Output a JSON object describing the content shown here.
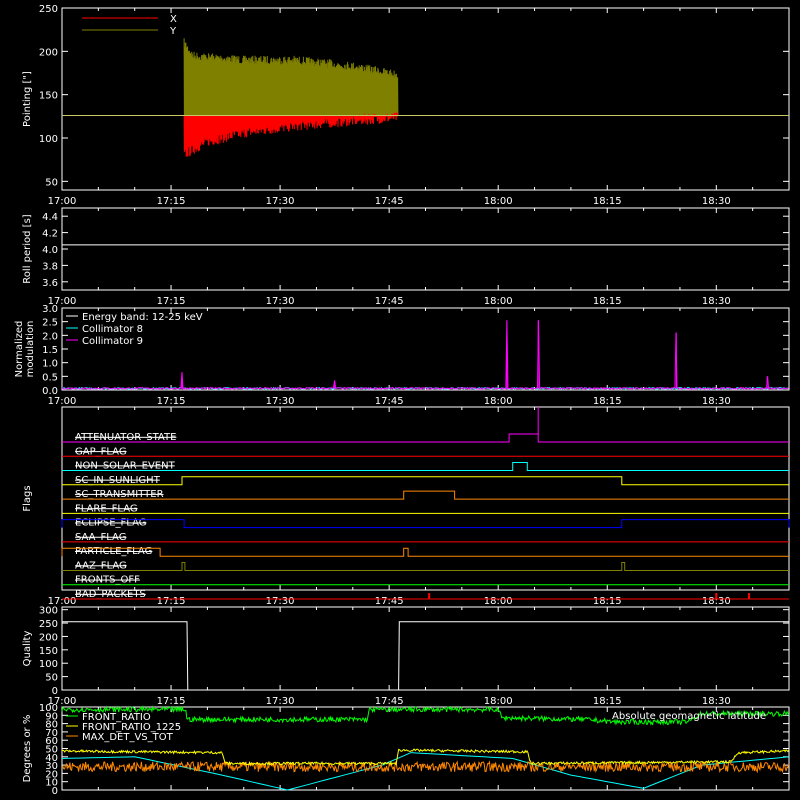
{
  "colors": {
    "background": "#000000",
    "axes": "#ffffff",
    "x": "#ff0000",
    "y": "#808000",
    "ref_line": "#c8c864",
    "collimator8": "#00ffff",
    "collimator9": "#ff00ff",
    "front_ratio": "#00ff00",
    "front_ratio_1225": "#ffff00",
    "max_det": "#ff8800",
    "geomag": "#00ffff"
  },
  "chart_data": [
    {
      "id": "pointing",
      "type": "line",
      "ylabel": "Pointing [\"]",
      "ylim": [
        40,
        250
      ],
      "yticks": [
        "50",
        "100",
        "150",
        "200",
        "250"
      ],
      "ytick_values": [
        50,
        100,
        150,
        200,
        250
      ],
      "x_ticks": [
        "17:00",
        "17:15",
        "17:30",
        "17:45",
        "18:00",
        "18:15",
        "18:30"
      ],
      "x_tick_minutes": [
        0,
        15,
        30,
        45,
        60,
        75,
        90
      ],
      "xlim_minutes": [
        0,
        100
      ],
      "reference_level": 126,
      "legend": [
        {
          "name": "X",
          "color": "#ff0000"
        },
        {
          "name": "Y",
          "color": "#808000"
        }
      ],
      "series": [
        {
          "name": "Y",
          "start": 16.8,
          "end": 46.2,
          "upper": [
            [
              16.8,
              215
            ],
            [
              18,
              200
            ],
            [
              25,
              195
            ],
            [
              32,
              195
            ],
            [
              40,
              188
            ],
            [
              46.2,
              178
            ]
          ],
          "lower": [
            [
              16.8,
              126
            ],
            [
              46.2,
              126
            ]
          ]
        },
        {
          "name": "X",
          "start": 16.8,
          "end": 46.2,
          "upper": [
            [
              16.8,
              126
            ],
            [
              46.2,
              126
            ]
          ],
          "lower": [
            [
              16.8,
              75
            ],
            [
              20,
              90
            ],
            [
              25,
              100
            ],
            [
              32,
              108
            ],
            [
              40,
              114
            ],
            [
              46.2,
              118
            ]
          ]
        }
      ]
    },
    {
      "id": "roll",
      "type": "line",
      "ylabel": "Roll period [s]",
      "ylim": [
        3.5,
        4.5
      ],
      "yticks": [
        "3.6",
        "3.8",
        "4.0",
        "4.2",
        "4.4"
      ],
      "ytick_values": [
        3.6,
        3.8,
        4.0,
        4.2,
        4.4
      ],
      "x_ticks": [
        "17:00",
        "17:15",
        "17:30",
        "17:45",
        "18:00",
        "18:15",
        "18:30"
      ],
      "x_tick_minutes": [
        0,
        15,
        30,
        45,
        60,
        75,
        90
      ],
      "xlim_minutes": [
        0,
        100
      ],
      "series": [
        {
          "name": "",
          "points": [
            [
              0,
              4.05
            ],
            [
              100,
              4.05
            ]
          ]
        }
      ]
    },
    {
      "id": "modulation",
      "type": "line",
      "ylabel": "Normalized\nmodulation",
      "ylim": [
        0,
        3.0
      ],
      "yticks": [
        "0.0",
        "0.5",
        "1.0",
        "1.5",
        "2.0",
        "2.5",
        "3.0"
      ],
      "ytick_values": [
        0,
        0.5,
        1.0,
        1.5,
        2.0,
        2.5,
        3.0
      ],
      "x_ticks": [
        "17:00",
        "17:15",
        "17:30",
        "17:45",
        "18:00",
        "18:15",
        "18:30"
      ],
      "x_tick_minutes": [
        0,
        15,
        30,
        45,
        60,
        75,
        90
      ],
      "xlim_minutes": [
        0,
        100
      ],
      "legend": [
        {
          "name": "Energy band: 12-25 keV",
          "color": "#ffffff"
        },
        {
          "name": "Collimator 8",
          "color": "#00ffff"
        },
        {
          "name": "Collimator 9",
          "color": "#ff00ff"
        }
      ],
      "spikes": [
        [
          16.5,
          0.65
        ],
        [
          37.5,
          0.35
        ],
        [
          61.2,
          2.55
        ],
        [
          65.5,
          2.55
        ],
        [
          84.5,
          2.1
        ],
        [
          97,
          0.5
        ]
      ]
    },
    {
      "id": "flags",
      "type": "line",
      "ylabel": "Flags",
      "x_ticks": [
        "17:00",
        "17:15",
        "17:30",
        "17:45",
        "18:00",
        "18:15",
        "18:30"
      ],
      "x_tick_minutes": [
        0,
        15,
        30,
        45,
        60,
        75,
        90
      ],
      "xlim_minutes": [
        0,
        100
      ],
      "flags": [
        {
          "name": "ATTENUATOR_STATE",
          "color": "#ff00ff",
          "segments": [
            [
              61.5,
              65.5,
              1
            ],
            [
              65.5,
              100,
              0
            ]
          ],
          "spike": [
            65.5,
            2
          ]
        },
        {
          "name": "GAP_FLAG",
          "color": "#ff0000",
          "segments": []
        },
        {
          "name": "NON_SOLAR_EVENT",
          "color": "#00ffff",
          "segments": [
            [
              62,
              64,
              1
            ]
          ]
        },
        {
          "name": "SC_IN_SUNLIGHT",
          "color": "#ffff00",
          "segments": [
            [
              16.5,
              77,
              1
            ]
          ]
        },
        {
          "name": "SC_TRANSMITTER",
          "color": "#ff8800",
          "segments": [
            [
              47,
              54,
              1
            ]
          ]
        },
        {
          "name": "FLARE_FLAG",
          "color": "#ffff00",
          "segments": []
        },
        {
          "name": "ECLIPSE_FLAG",
          "color": "#0000ff",
          "segments": [
            [
              0,
              16.8,
              1
            ],
            [
              77,
              100,
              1
            ]
          ]
        },
        {
          "name": "SAA_FLAG",
          "color": "#ff0000",
          "segments": []
        },
        {
          "name": "PARTICLE_FLAG",
          "color": "#ff8800",
          "segments": [
            [
              0,
              13.5,
              1
            ],
            [
              47,
              47.6,
              1
            ]
          ]
        },
        {
          "name": "AAZ_FLAG",
          "color": "#808000",
          "segments": [
            [
              16.5,
              16.9,
              1
            ],
            [
              77,
              77.4,
              1
            ]
          ]
        },
        {
          "name": "FRONTS_OFF",
          "color": "#00ff00",
          "segments": []
        },
        {
          "name": "BAD_PACKETS",
          "color": "#ff0000",
          "spikes_at": [
            50.5,
            90,
            94.5
          ]
        }
      ]
    },
    {
      "id": "quality",
      "type": "line",
      "ylabel": "Quality",
      "ylim": [
        0,
        310
      ],
      "yticks": [
        "0",
        "50",
        "100",
        "150",
        "200",
        "250",
        "300"
      ],
      "ytick_values": [
        0,
        50,
        100,
        150,
        200,
        250,
        300
      ],
      "x_ticks": [
        "17:00",
        "17:15",
        "17:30",
        "17:45",
        "18:00",
        "18:15",
        "18:30"
      ],
      "x_tick_minutes": [
        0,
        15,
        30,
        45,
        60,
        75,
        90
      ],
      "xlim_minutes": [
        0,
        100
      ],
      "series": [
        {
          "name": "",
          "points": [
            [
              0,
              255
            ],
            [
              17.2,
              255
            ],
            [
              17.3,
              0
            ],
            [
              46.3,
              0
            ],
            [
              46.4,
              255
            ],
            [
              100,
              255
            ]
          ]
        }
      ]
    },
    {
      "id": "ratios",
      "type": "line",
      "ylabel": "Degrees or %",
      "ylim": [
        0,
        100
      ],
      "yticks": [
        "0",
        "10",
        "20",
        "30",
        "40",
        "50",
        "60",
        "70",
        "80",
        "90",
        "100"
      ],
      "ytick_values": [
        0,
        10,
        20,
        30,
        40,
        50,
        60,
        70,
        80,
        90,
        100
      ],
      "xlim_minutes": [
        0,
        100
      ],
      "legend": [
        {
          "name": "FRONT_RATIO",
          "color": "#00ff00"
        },
        {
          "name": "FRONT_RATIO_1225",
          "color": "#ffff00"
        },
        {
          "name": "MAX_DET_VS_TOT",
          "color": "#ff8800"
        },
        {
          "name": "Absolute geomagnetic latitude",
          "color": "#00ffff"
        }
      ],
      "series": [
        {
          "name": "FRONT_RATIO",
          "points": [
            [
              0,
              97
            ],
            [
              17,
              97
            ],
            [
              17.2,
              85
            ],
            [
              42,
              85
            ],
            [
              42.3,
              97
            ],
            [
              60,
              97
            ],
            [
              60.5,
              87
            ],
            [
              72,
              85
            ],
            [
              76,
              82
            ],
            [
              86,
              82
            ],
            [
              88,
              92
            ],
            [
              100,
              92
            ]
          ]
        },
        {
          "name": "FRONT_RATIO_1225",
          "points": [
            [
              0,
              47
            ],
            [
              22,
              45
            ],
            [
              22.5,
              32
            ],
            [
              46,
              32
            ],
            [
              46.3,
              48
            ],
            [
              64,
              46
            ],
            [
              64.5,
              32
            ],
            [
              92,
              34
            ],
            [
              93,
              45
            ],
            [
              100,
              47
            ]
          ]
        },
        {
          "name": "MAX_DET_VS_TOT",
          "points": [
            [
              0,
              28
            ],
            [
              100,
              28
            ]
          ]
        },
        {
          "name": "Absolute geomagnetic latitude",
          "points": [
            [
              0,
              38
            ],
            [
              10,
              40
            ],
            [
              22,
              18
            ],
            [
              31,
              0
            ],
            [
              44,
              30
            ],
            [
              48,
              45
            ],
            [
              62,
              38
            ],
            [
              70,
              18
            ],
            [
              80,
              2
            ],
            [
              88,
              30
            ],
            [
              100,
              40
            ]
          ]
        }
      ]
    }
  ]
}
